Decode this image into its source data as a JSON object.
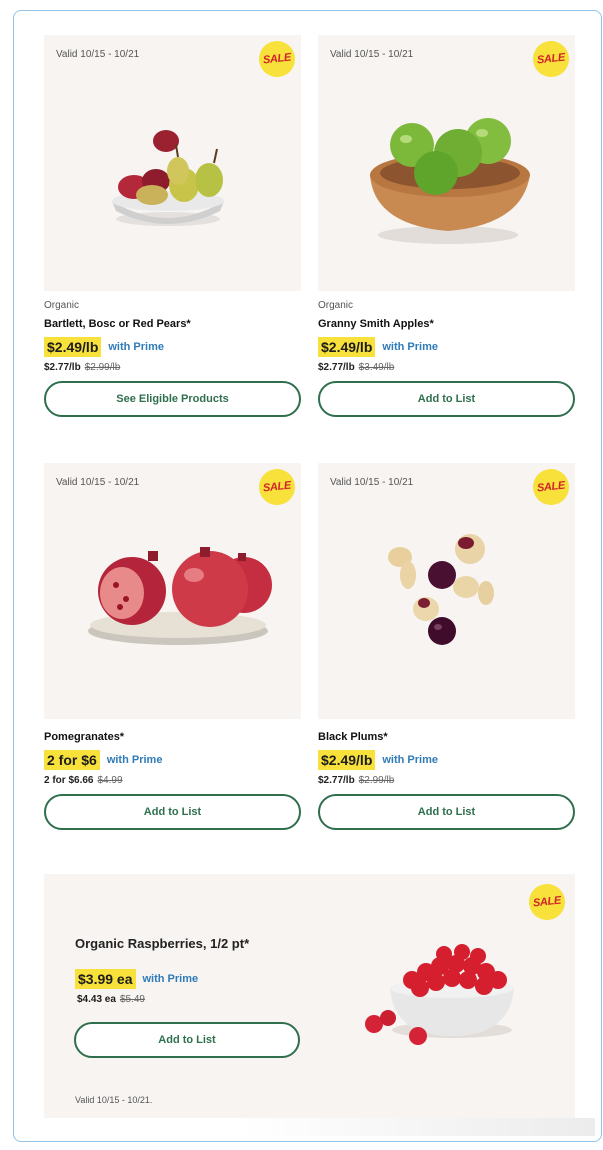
{
  "products": [
    {
      "valid": "Valid 10/15 - 10/21",
      "sale_badge": "SALE",
      "eyebrow": "Organic",
      "title": "Bartlett, Bosc or Red Pears*",
      "prime_price": "$2.49/lb",
      "with_prime": "with Prime",
      "reg_price": "$2.77/lb",
      "was_price": "$2.99/lb",
      "button": "See Eligible Products",
      "image": "pears-bowl"
    },
    {
      "valid": "Valid 10/15 - 10/21",
      "sale_badge": "SALE",
      "eyebrow": "Organic",
      "title": "Granny Smith Apples*",
      "prime_price": "$2.49/lb",
      "with_prime": "with Prime",
      "reg_price": "$2.77/lb",
      "was_price": "$3.49/lb",
      "button": "Add to List",
      "image": "green-apples-bowl"
    },
    {
      "valid": "Valid 10/15 - 10/21",
      "sale_badge": "SALE",
      "eyebrow": "",
      "title": "Pomegranates*",
      "prime_price": "2 for $6",
      "with_prime": "with Prime",
      "reg_price": "2 for $6.66",
      "was_price": "$4.99",
      "button": "Add to List",
      "image": "pomegranates-plate"
    },
    {
      "valid": "Valid 10/15 - 10/21",
      "sale_badge": "SALE",
      "eyebrow": "",
      "title": "Black Plums*",
      "prime_price": "$2.49/lb",
      "with_prime": "with Prime",
      "reg_price": "$2.77/lb",
      "was_price": "$2.99/lb",
      "button": "Add to List",
      "image": "black-plums"
    }
  ],
  "banner": {
    "sale_badge": "SALE",
    "title": "Organic Raspberries, 1/2 pt*",
    "prime_price": "$3.99 ea",
    "with_prime": "with Prime",
    "reg_price": "$4.43 ea",
    "was_price": "$5.49",
    "button": "Add to List",
    "valid": "Valid 10/15 - 10/21.",
    "image": "raspberries-bowl"
  },
  "colors": {
    "highlight": "#f7e13a",
    "prime_blue": "#2f7bb8",
    "button_green": "#2f6f4e",
    "sale_red": "#d2232a",
    "tile_bg": "#f7f4f2",
    "frame_border": "#93c4e8"
  }
}
